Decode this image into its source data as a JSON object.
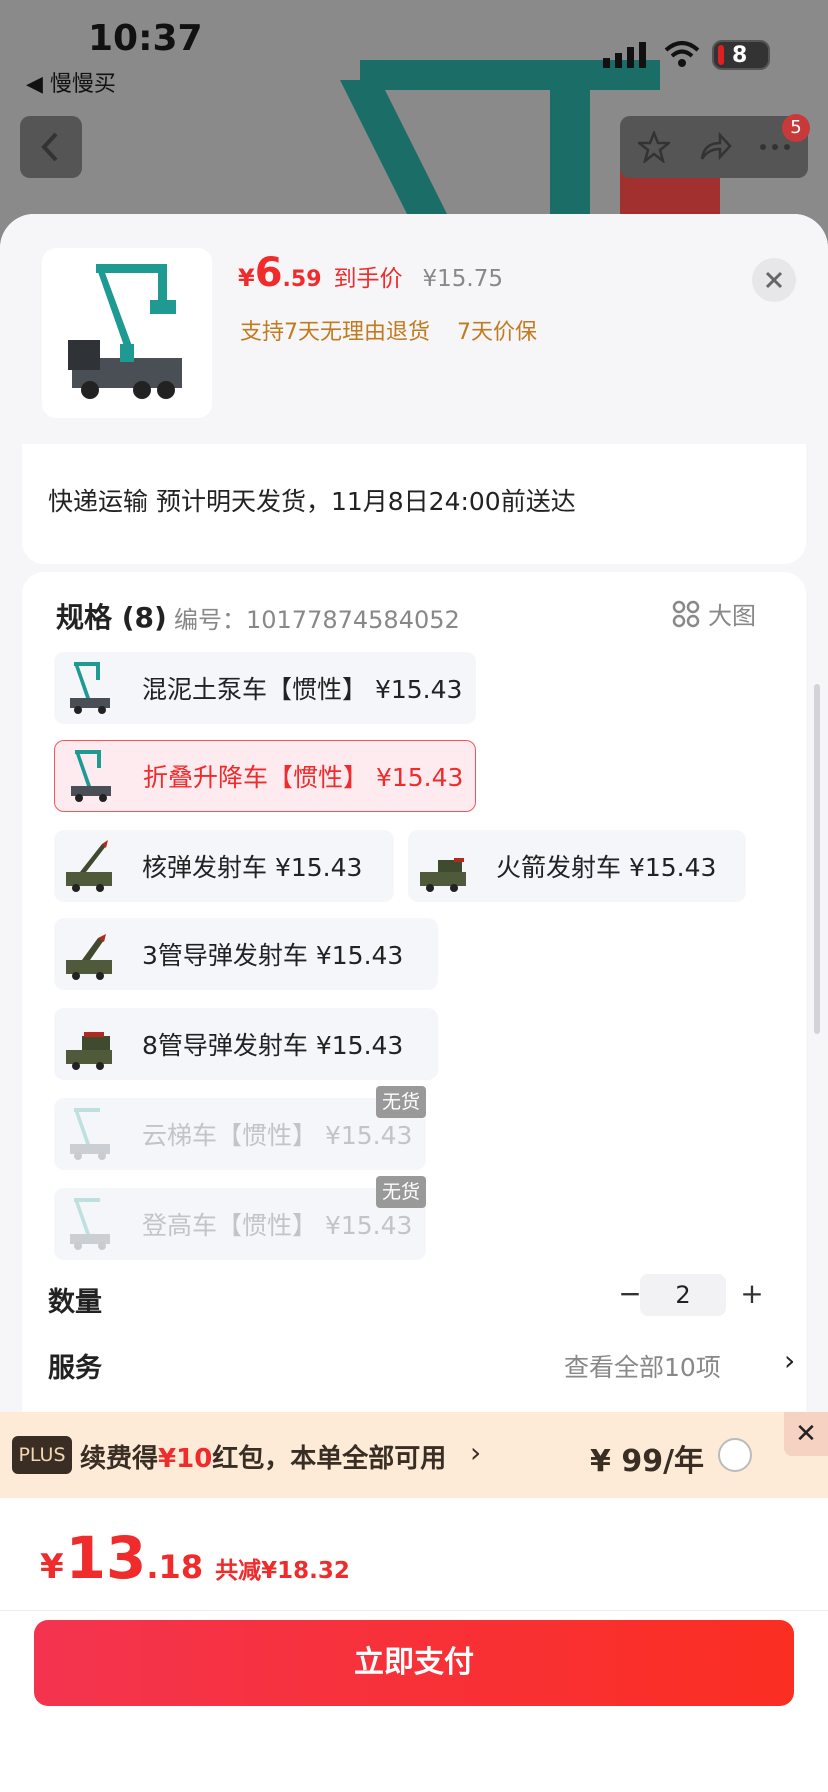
{
  "status_bar": {
    "time": "10:37",
    "back_app": "◀ 慢慢买",
    "battery": "8"
  },
  "nav": {
    "badge_count": "5"
  },
  "product": {
    "price_symbol": "¥",
    "price_int": "6",
    "price_dec": ".59",
    "price_label": "到手价",
    "original_price": "¥15.75",
    "policies": [
      "支持7天无理由退货",
      "7天价保"
    ]
  },
  "shipping": {
    "text": "快递运输 预计明天发货，11月8日24:00前送达"
  },
  "spec": {
    "title": "规格 (8)",
    "code": "编号：10177874584052",
    "big_picture": "大图",
    "options": [
      {
        "label": "混泥土泵车【惯性】 ¥15.43",
        "state": "normal",
        "image": "crane-truck"
      },
      {
        "label": "折叠升降车【惯性】 ¥15.43",
        "state": "selected",
        "image": "crane-truck"
      },
      {
        "label": "核弹发射车   ¥15.43",
        "state": "normal",
        "image": "missile-truck"
      },
      {
        "label": "火箭发射车   ¥15.43",
        "state": "normal",
        "image": "rocket-truck"
      },
      {
        "label": "3管导弹发射车   ¥15.43",
        "state": "normal",
        "image": "missile-truck"
      },
      {
        "label": "8管导弹发射车   ¥15.43",
        "state": "normal",
        "image": "rocket-truck"
      },
      {
        "label": "云梯车【惯性】 ¥15.43",
        "state": "disabled",
        "image": "crane-truck",
        "badge": "无货"
      },
      {
        "label": "登高车【惯性】 ¥15.43",
        "state": "disabled",
        "image": "crane-truck",
        "badge": "无货"
      }
    ]
  },
  "quantity": {
    "label": "数量",
    "value": "2",
    "minus": "−",
    "plus": "+"
  },
  "service": {
    "label": "服务",
    "more": "查看全部10项",
    "arrow": "›"
  },
  "plus_banner": {
    "badge": "PLUS",
    "text_before": "续费得",
    "text_red": "¥10",
    "text_after": "红包，本单全部可用",
    "arrow": "›",
    "price": "¥ 99/年",
    "close": "✕"
  },
  "bottom": {
    "total_symbol": "¥",
    "total_int": "13",
    "total_dec": ".18",
    "savings": "共减¥18.32",
    "pay_label": "立即支付"
  },
  "colors": {
    "accent": "#f02b2b",
    "policy": "#c27a1e",
    "truck_teal": "#1e9a92"
  }
}
